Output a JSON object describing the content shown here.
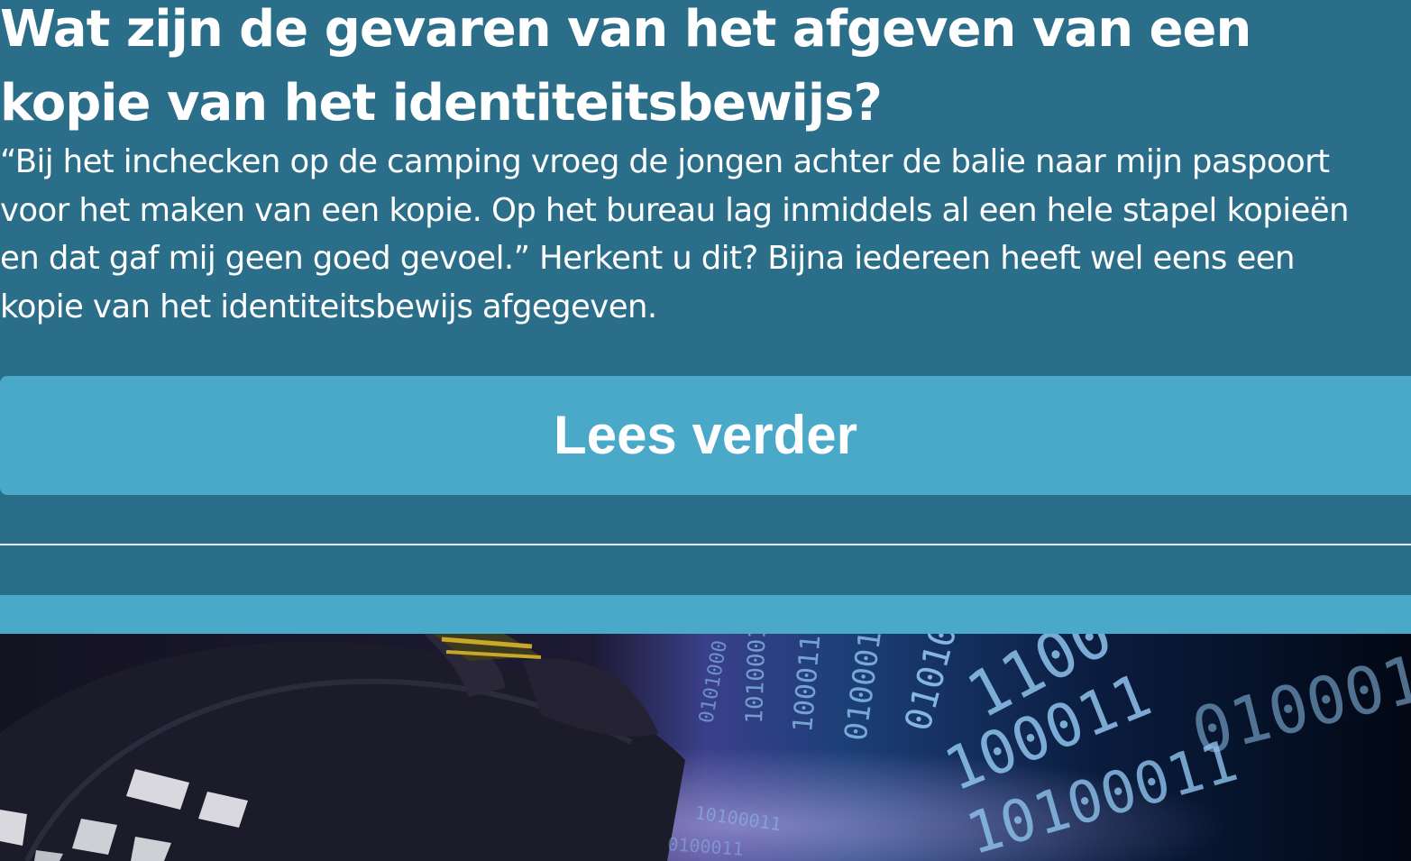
{
  "article": {
    "title": "Wat zijn de gevaren van het afgeven van een kopie van het identiteitsbewijs?",
    "intro_lines": [
      "“Bij het inchecken op de camping vroeg de jongen achter de balie naar mijn paspoort",
      "voor het maken van een kopie. Op het bureau lag inmiddels al een hele stapel kopieën",
      "en dat gaf mij geen goed gevoel.” Herkent u dit? Bijna iedereen heeft wel eens een",
      "kopie van het identiteitsbewijs afgegeven."
    ],
    "read_more_label": "Lees verder"
  },
  "hero": {
    "binary_rows": [
      "1100",
      "100011",
      "0100011",
      "10100011",
      "0101000"
    ]
  },
  "colors": {
    "background": "#2a6e89",
    "button": "#4aa8c9",
    "text": "#ffffff"
  }
}
